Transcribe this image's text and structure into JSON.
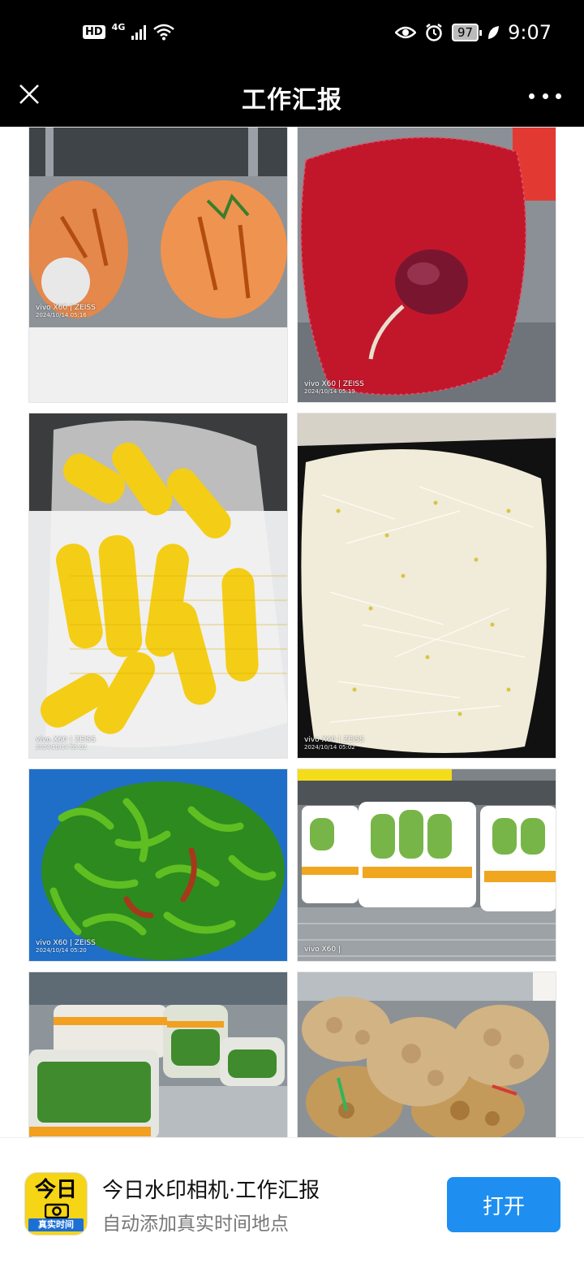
{
  "status_bar": {
    "hd": "HD",
    "network": "4G",
    "battery": "97",
    "time": "9:07",
    "icons": [
      "signal-icon",
      "wifi-icon",
      "eye-icon",
      "alarm-icon",
      "leaf-icon"
    ]
  },
  "header": {
    "title": "工作汇报",
    "close_icon": "close-icon",
    "more_icon": "more-icon"
  },
  "photos": [
    {
      "subject": "carrots",
      "brand": "vivo X60 | ZEISS",
      "date": "2024/10/14 05:16"
    },
    {
      "subject": "red onions",
      "brand": "vivo X60 | ZEISS",
      "date": "2024/10/14 05:19"
    },
    {
      "subject": "corn",
      "brand": "vivo X60 | ZEISS",
      "date": "2024/10/14 05:02"
    },
    {
      "subject": "bean sprouts",
      "brand": "vivo X60 | ZEISS",
      "date": "2024/10/14 05:02"
    },
    {
      "subject": "green peppers",
      "brand": "vivo X60 | ZEISS",
      "date": "2024/10/14 05:20"
    },
    {
      "subject": "bok choy",
      "brand": "vivo X60 |",
      "date": ""
    },
    {
      "subject": "bagged greens",
      "brand": "",
      "date": ""
    },
    {
      "subject": "ginger",
      "brand": "",
      "date": ""
    }
  ],
  "banner": {
    "icon_big": "今日",
    "icon_small": "真实时间",
    "app_name": "今日水印相机·工作汇报",
    "app_desc": "自动添加真实时间地点",
    "open_label": "打开"
  }
}
